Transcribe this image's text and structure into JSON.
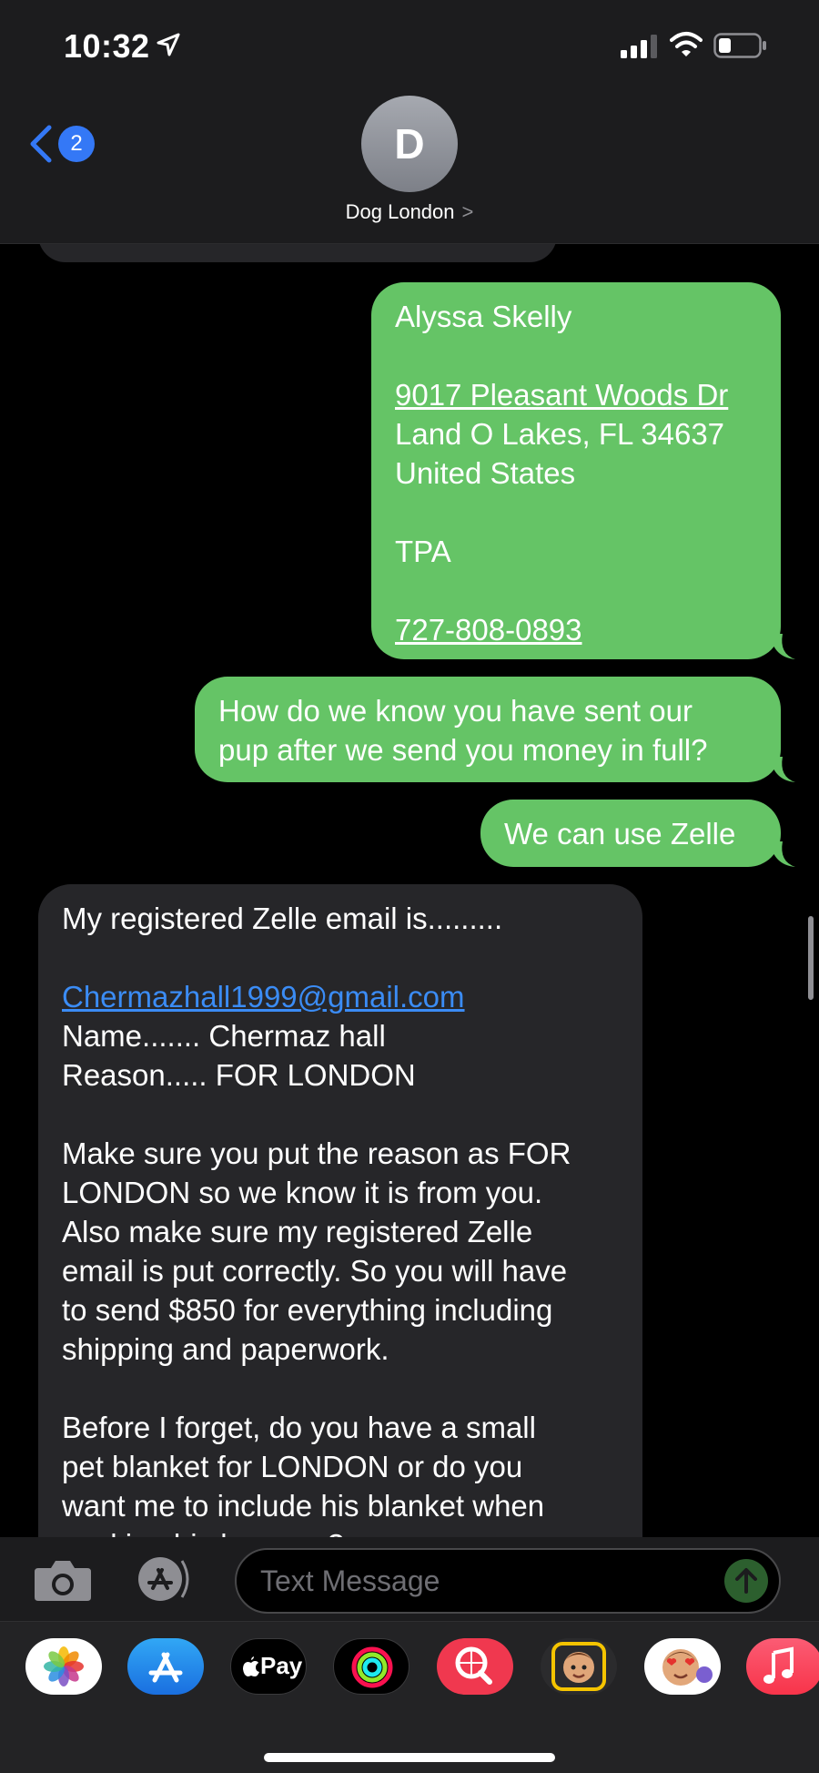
{
  "status_bar": {
    "time": "10:32"
  },
  "header": {
    "back_badge": "2",
    "avatar_initial": "D",
    "contact_name": "Dog London",
    "contact_chevron": ">"
  },
  "messages": [
    {
      "direction": "outgoing",
      "lines": [
        "Alyssa Skelly",
        "",
        "9017 Pleasant Woods Dr",
        "Land O Lakes, FL  34637",
        "United States",
        "",
        "TPA",
        "",
        "727-808-0893"
      ]
    },
    {
      "direction": "outgoing",
      "lines": [
        "How do we know you have sent our",
        "pup after we send you money in full?"
      ]
    },
    {
      "direction": "outgoing",
      "lines": [
        "We can use Zelle"
      ]
    },
    {
      "direction": "incoming",
      "lines": [
        "My registered Zelle email is.........",
        "",
        "Chermazhall1999@gmail.com",
        "Name....... Chermaz hall",
        "Reason..... FOR LONDON",
        "",
        "Make sure you put the reason as FOR",
        "LONDON so we know it is from you.",
        "Also make sure my registered Zelle",
        "email is put correctly. So you will have",
        "to send $850  for everything including",
        "shipping and paperwork.",
        "",
        "Before I forget, do you have a small",
        "pet blanket for LONDON or do you",
        "want me to include his blanket when",
        "packing his luggage?"
      ]
    }
  ],
  "input": {
    "placeholder": "Text Message"
  },
  "drawer_apps": [
    "photos-icon",
    "app-store-icon",
    "apple-pay-icon",
    "activity-icon",
    "search-images-icon",
    "memoji-icon",
    "animoji-stickers-icon",
    "music-icon"
  ],
  "drawer_labels": {
    "apple_pay": "Pay"
  },
  "colors": {
    "outgoing": "#65c466",
    "incoming": "#262629",
    "link": "#3b8cf5",
    "accent": "#3478f6"
  }
}
